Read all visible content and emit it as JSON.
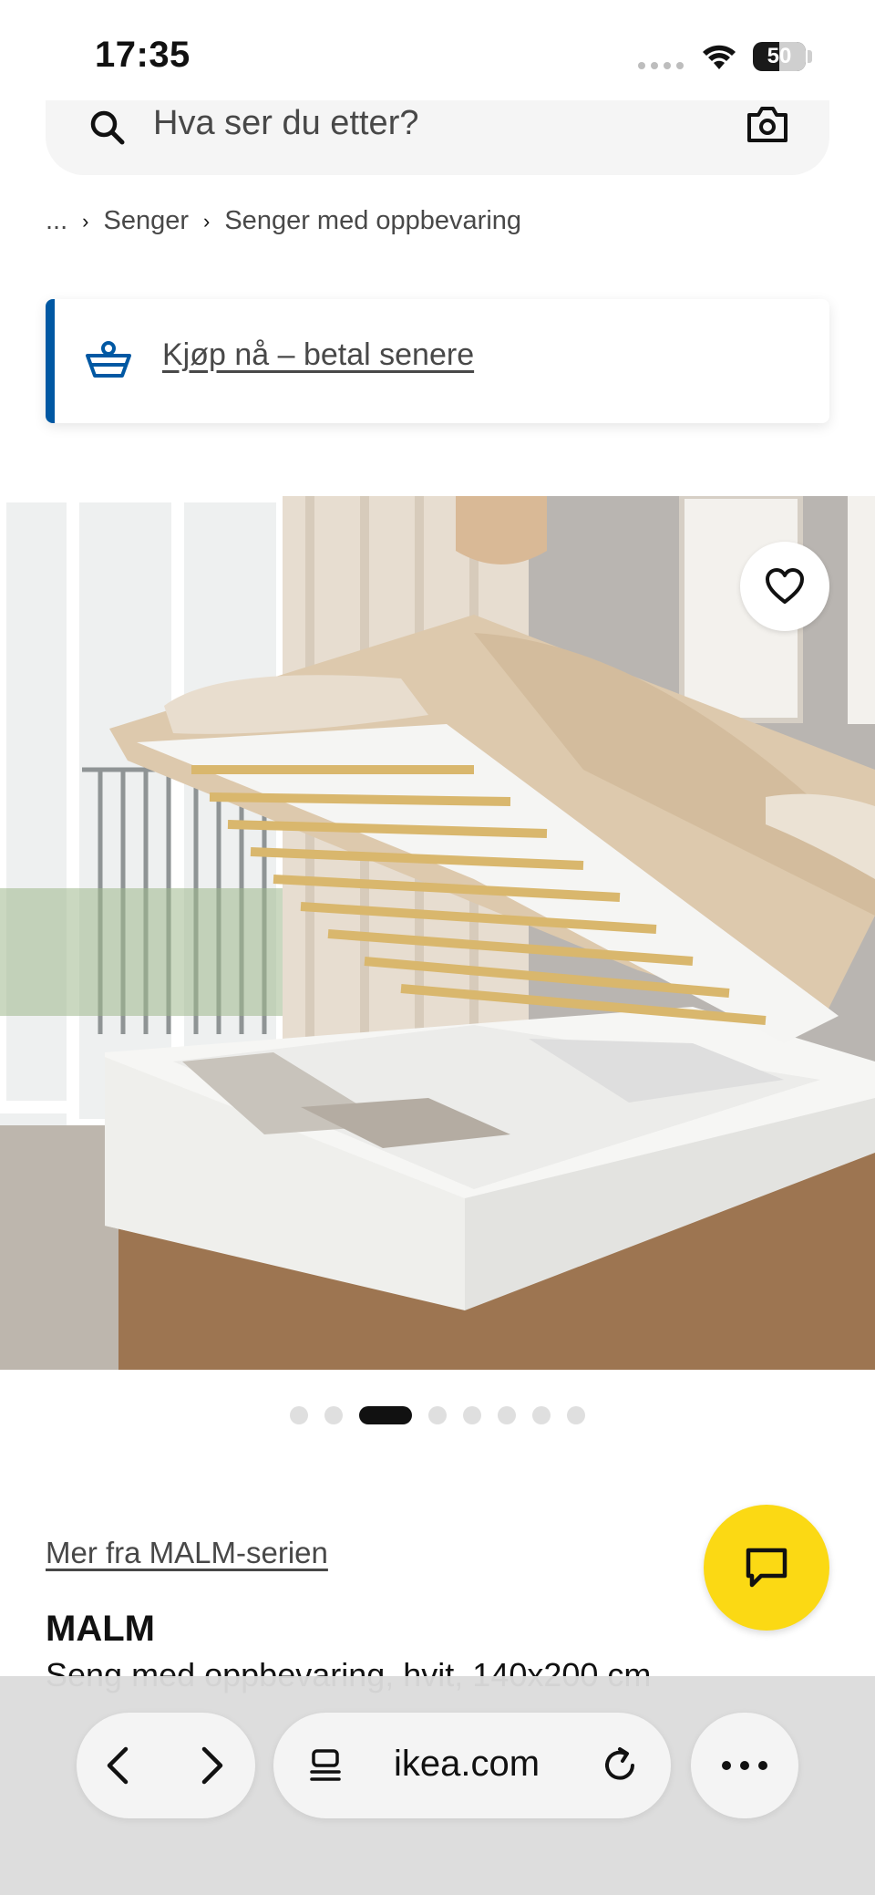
{
  "status_bar": {
    "time": "17:35",
    "battery": "50",
    "battery_level": 0.5
  },
  "search": {
    "placeholder": "Hva ser du etter?"
  },
  "breadcrumb": {
    "ellipsis": "...",
    "items": [
      "Senger",
      "Senger med oppbevaring"
    ]
  },
  "payment_banner": {
    "link_text": "Kjøp nå – betal senere",
    "accent_color": "#0058a3"
  },
  "gallery": {
    "total_images": 8,
    "active_index": 2
  },
  "product": {
    "series_link": "Mer fra MALM-serien",
    "name": "MALM",
    "description": "Seng med oppbevaring, hvit, 140x200 cm"
  },
  "chat": {
    "color": "#fbd914",
    "icon": "chat-icon"
  },
  "browser": {
    "url": "ikea.com"
  }
}
